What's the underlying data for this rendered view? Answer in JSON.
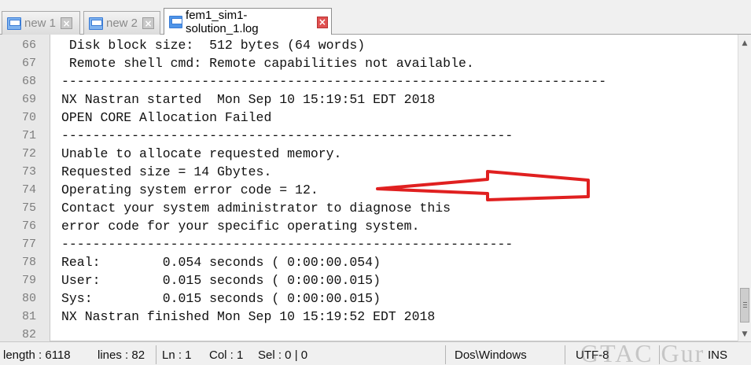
{
  "tabs": [
    {
      "label": "new 1",
      "active": false,
      "icon": "file-icon"
    },
    {
      "label": "new 2",
      "active": false,
      "icon": "file-icon"
    },
    {
      "label": "fem1_sim1-solution_1.log",
      "active": true,
      "icon": "file-icon"
    }
  ],
  "tab_close_glyph": "×",
  "lines": [
    {
      "n": "66",
      "text": " Disk block size:  512 bytes (64 words)"
    },
    {
      "n": "67",
      "text": " Remote shell cmd: Remote capabilities not available."
    },
    {
      "n": "68",
      "text": "----------------------------------------------------------------------"
    },
    {
      "n": "69",
      "text": "NX Nastran started  Mon Sep 10 15:19:51 EDT 2018"
    },
    {
      "n": "70",
      "text": "OPEN CORE Allocation Failed"
    },
    {
      "n": "71",
      "text": "----------------------------------------------------------"
    },
    {
      "n": "72",
      "text": "Unable to allocate requested memory."
    },
    {
      "n": "73",
      "text": "Requested size = 14 Gbytes."
    },
    {
      "n": "74",
      "text": "Operating system error code = 12."
    },
    {
      "n": "75",
      "text": "Contact your system administrator to diagnose this"
    },
    {
      "n": "76",
      "text": "error code for your specific operating system."
    },
    {
      "n": "77",
      "text": "----------------------------------------------------------"
    },
    {
      "n": "78",
      "text": "Real:        0.054 seconds ( 0:00:00.054)"
    },
    {
      "n": "79",
      "text": "User:        0.015 seconds ( 0:00:00.015)"
    },
    {
      "n": "80",
      "text": "Sys:         0.015 seconds ( 0:00:00.015)"
    },
    {
      "n": "81",
      "text": "NX Nastran finished Mon Sep 10 15:19:52 EDT 2018"
    },
    {
      "n": "82",
      "text": ""
    }
  ],
  "annotation": {
    "type": "red-arrow",
    "points_to_line": "72",
    "color": "#e02020"
  },
  "status": {
    "length": "length : 6118",
    "lines": "lines : 82",
    "ln": "Ln : 1",
    "col": "Col : 1",
    "sel": "Sel : 0 | 0",
    "eol": "Dos\\Windows",
    "encoding": "UTF-8",
    "mode": "INS"
  },
  "watermark": "GTAC Gur",
  "colors": {
    "arrow": "#e02020",
    "gutter": "#e8e8e8",
    "active_close": "#e05050"
  }
}
